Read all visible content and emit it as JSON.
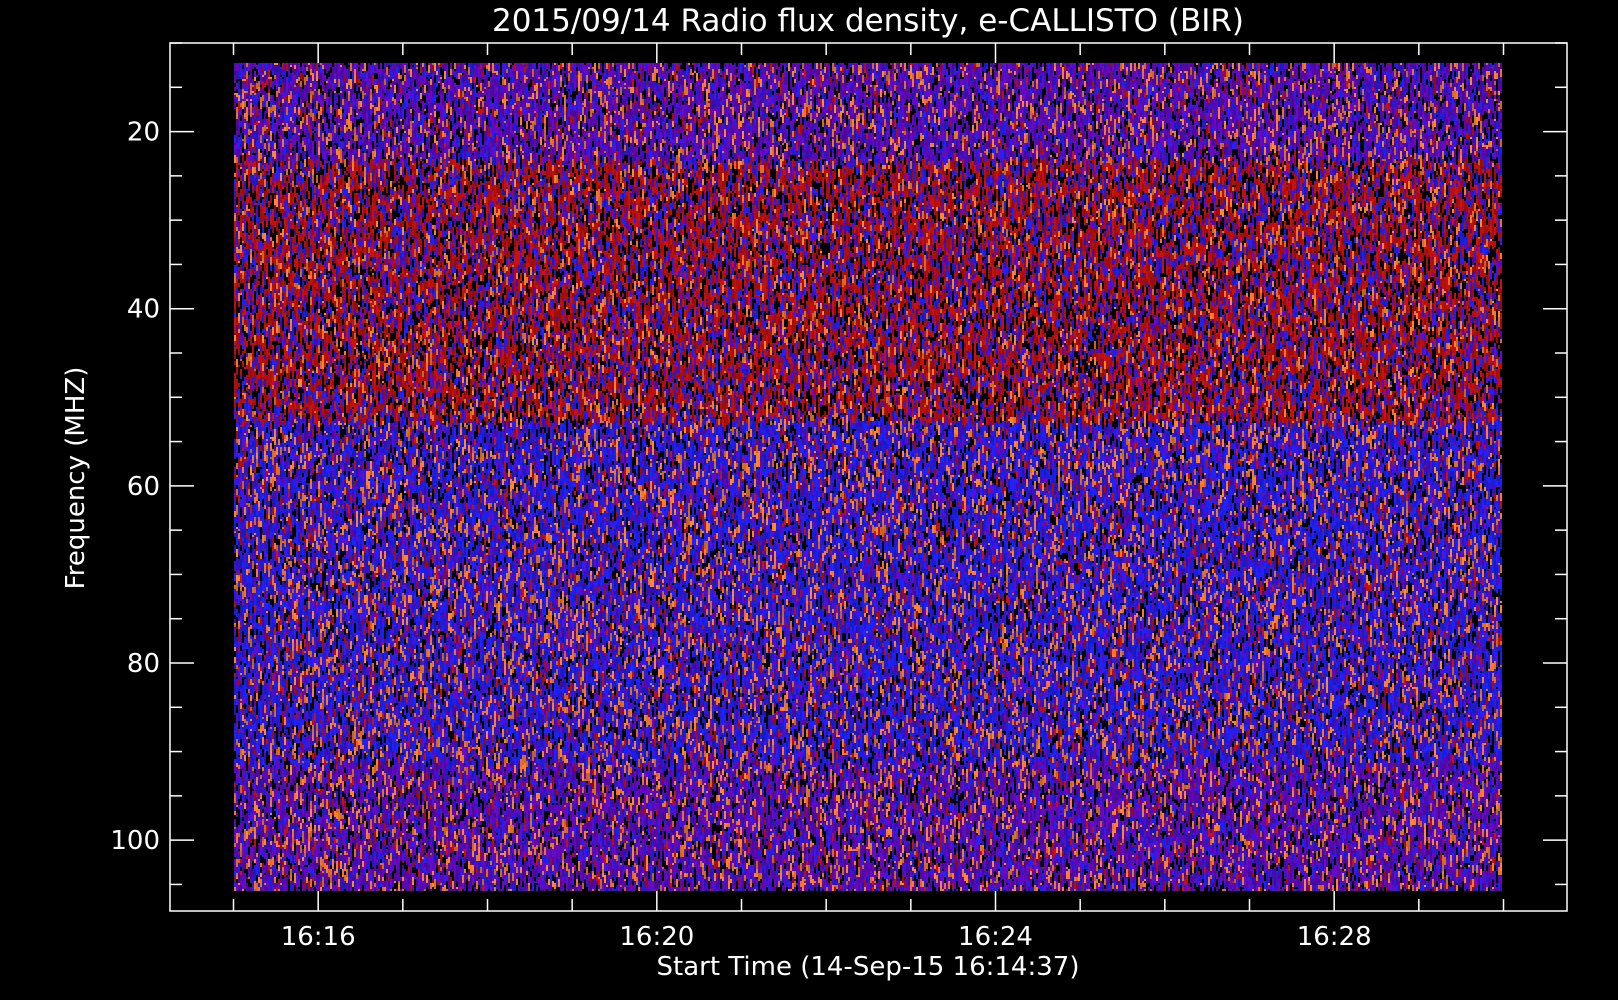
{
  "chart_data": {
    "type": "heatmap",
    "title": "2015/09/14  Radio flux density, e-CALLISTO (BIR)",
    "xlabel": "Start Time (14-Sep-15 16:14:37)",
    "ylabel": "Frequency (MHZ)",
    "x_ticks": [
      {
        "label": "16:16",
        "minutes": 16
      },
      {
        "label": "16:20",
        "minutes": 20
      },
      {
        "label": "16:24",
        "minutes": 24
      },
      {
        "label": "16:28",
        "minutes": 28
      }
    ],
    "y_ticks": [
      {
        "label": "20",
        "value": 20
      },
      {
        "label": "40",
        "value": 40
      },
      {
        "label": "60",
        "value": 60
      },
      {
        "label": "80",
        "value": 80
      },
      {
        "label": "100",
        "value": 100
      }
    ],
    "x_minor_step_minutes": 1,
    "y_minor_step": 5,
    "xlim": [
      "16:14:15",
      "16:30:45"
    ],
    "ylim": [
      108,
      10
    ],
    "data_time_range": [
      "16:15:00",
      "16:30:00"
    ],
    "data_freq_range_mhz": [
      10,
      105
    ],
    "frequency_bands": [
      {
        "from_mhz": 10,
        "to_mhz": 21,
        "dominant": "purple"
      },
      {
        "from_mhz": 21,
        "to_mhz": 51,
        "dominant": "red"
      },
      {
        "from_mhz": 51,
        "to_mhz": 90,
        "dominant": "blue"
      },
      {
        "from_mhz": 90,
        "to_mhz": 105,
        "dominant": "purple"
      }
    ],
    "colors": {
      "background": "#000000",
      "axes": "#ffffff",
      "purple": "#5a0ab4",
      "red": "#b40f0f",
      "blue": "#1e1ee6",
      "orange": "#f07828",
      "dark": "#000000"
    }
  }
}
